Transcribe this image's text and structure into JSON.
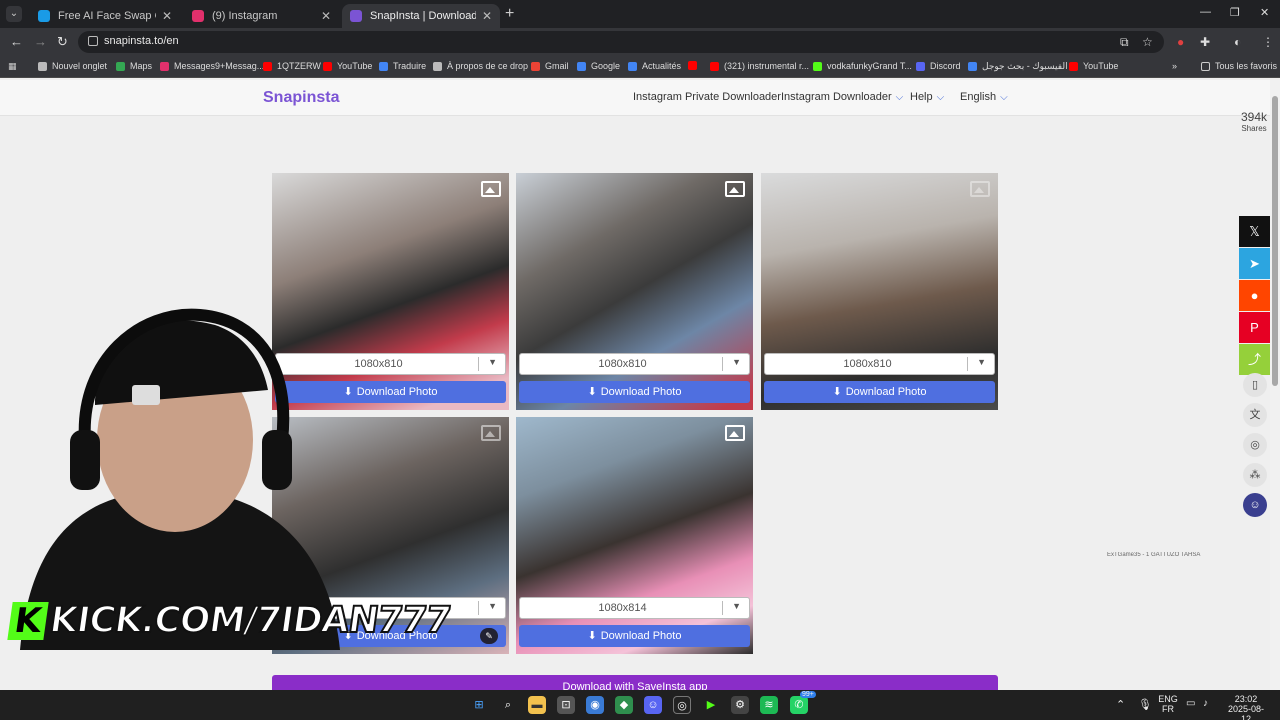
{
  "browser": {
    "tabs": [
      {
        "title": "Free AI Face Swap Online (No S",
        "color": "#1a9be6"
      },
      {
        "title": "(9) Instagram",
        "color": "#e1306c"
      },
      {
        "title": "SnapInsta | Download Instagram",
        "color": "#7b54d4"
      }
    ],
    "url": "snapinsta.to/en",
    "bookmarks": [
      {
        "label": "Nouvel onglet",
        "color": "#bbbbbb"
      },
      {
        "label": "Maps",
        "color": "#34a853"
      },
      {
        "label": "Messages9+Messag...",
        "color": "#e1306c"
      },
      {
        "label": "1QTZERW",
        "color": "#ff0000"
      },
      {
        "label": "YouTube",
        "color": "#ff0000"
      },
      {
        "label": "Traduire",
        "color": "#4285f4"
      },
      {
        "label": "À propos de ce drop",
        "color": "#bbbbbb"
      },
      {
        "label": "Gmail",
        "color": "#ea4335"
      },
      {
        "label": "Google",
        "color": "#4285f4"
      },
      {
        "label": "Actualités",
        "color": "#4285f4"
      },
      {
        "label": "",
        "color": "#ff0000"
      },
      {
        "label": "(321) instrumental r...",
        "color": "#ff0000"
      },
      {
        "label": "vodkafunkyGrand T...",
        "color": "#53fc18"
      },
      {
        "label": "Discord",
        "color": "#5865f2"
      },
      {
        "label": "الفيسبوك - بحث جوجل",
        "color": "#4285f4"
      },
      {
        "label": "YouTube",
        "color": "#ff0000"
      }
    ],
    "all_bookmarks": "Tous les favoris"
  },
  "site": {
    "logo": "Snapinsta",
    "nav": [
      {
        "label": "Instagram Private Downloader",
        "dropdown": false
      },
      {
        "label": "Instagram Downloader",
        "dropdown": true
      },
      {
        "label": "Help",
        "dropdown": true
      },
      {
        "label": "English",
        "dropdown": true
      }
    ]
  },
  "media": [
    {
      "resolution": "1080x810",
      "button": "Download Photo"
    },
    {
      "resolution": "1080x810",
      "button": "Download Photo"
    },
    {
      "resolution": "1080x810",
      "button": "Download Photo"
    },
    {
      "resolution": "",
      "button": "Download Photo"
    },
    {
      "resolution": "1080x814",
      "button": "Download Photo"
    }
  ],
  "app_banner": "Download with SaveInsta app",
  "share": {
    "count": "394k",
    "label": "Shares"
  },
  "overlay": {
    "kick": "KICK.COM/7IDAN777",
    "note": "ExTGame35 - 1 GATTUZO TAHSA"
  },
  "taskbar": {
    "lang_top": "ENG",
    "lang_bottom": "FR",
    "time": "23:02",
    "date": "2025-08-12",
    "badge": "99+"
  },
  "colors": {
    "accent": "#7b54d4",
    "download_button": "#4f6fe0",
    "app_banner": "#8a2dc8"
  }
}
